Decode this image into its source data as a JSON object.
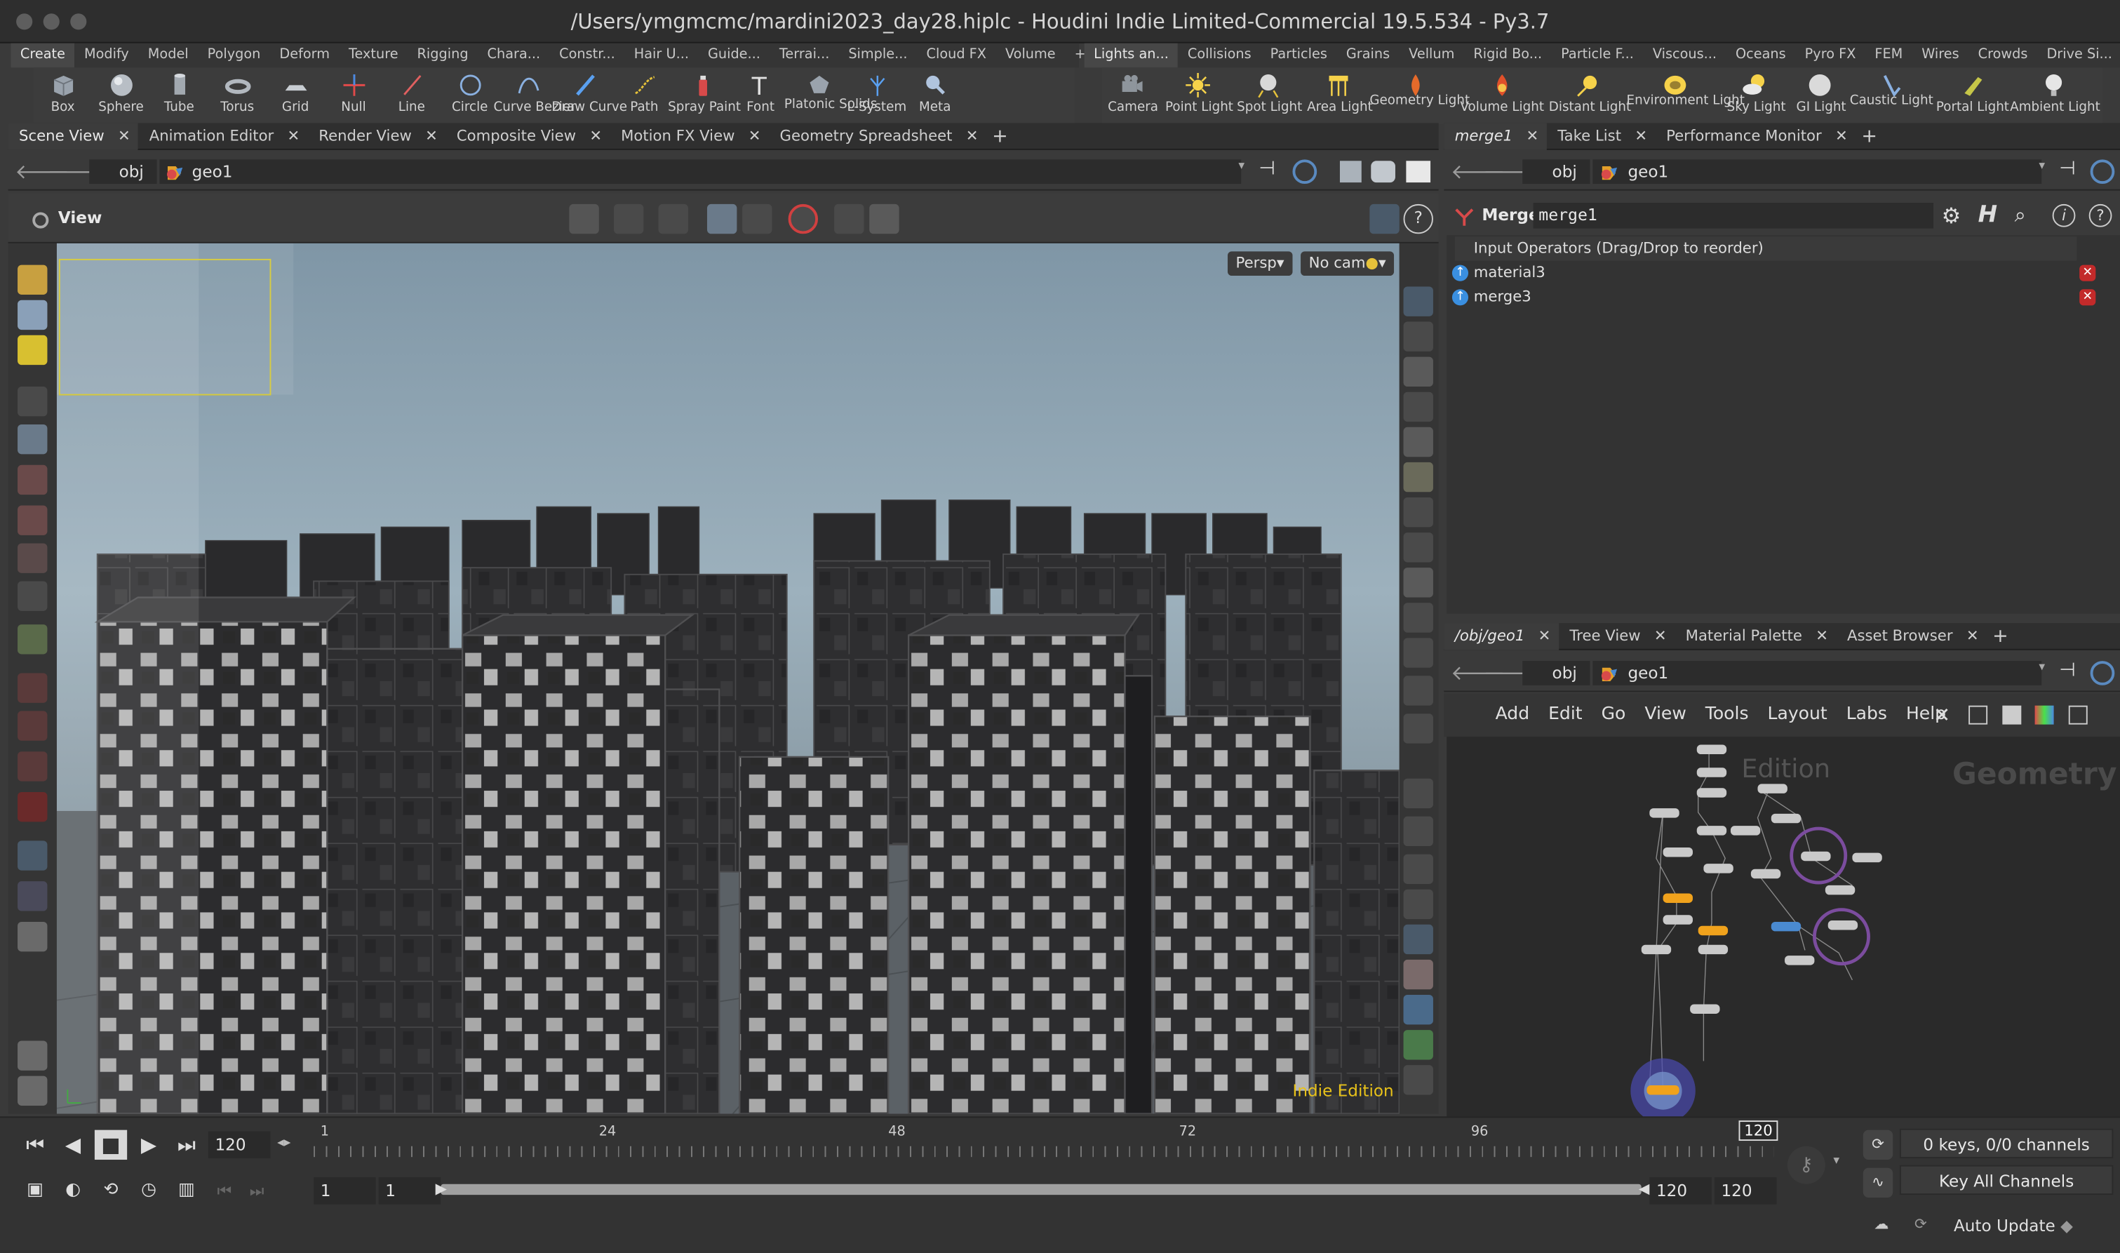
{
  "window": {
    "title": "/Users/ymgmcmc/mardini2023_day28.hiplc - Houdini Indie Limited-Commercial 19.5.534 - Py3.7"
  },
  "shelf_left": {
    "tabs": [
      "Create",
      "Modify",
      "Model",
      "Polygon",
      "Deform",
      "Texture",
      "Rigging",
      "Chara...",
      "Constr...",
      "Hair U...",
      "Guide...",
      "Terrai...",
      "Simple...",
      "Cloud FX",
      "Volume"
    ],
    "tools": [
      {
        "label": "Box",
        "icon": "box-icon"
      },
      {
        "label": "Sphere",
        "icon": "sphere-icon"
      },
      {
        "label": "Tube",
        "icon": "tube-icon"
      },
      {
        "label": "Torus",
        "icon": "torus-icon"
      },
      {
        "label": "Grid",
        "icon": "grid-icon"
      },
      {
        "label": "Null",
        "icon": "null-icon"
      },
      {
        "label": "Line",
        "icon": "line-icon"
      },
      {
        "label": "Circle",
        "icon": "circle-icon"
      },
      {
        "label": "Curve Bezier",
        "icon": "curve-bezier-icon"
      },
      {
        "label": "Draw Curve",
        "icon": "draw-curve-icon"
      },
      {
        "label": "Path",
        "icon": "path-icon"
      },
      {
        "label": "Spray Paint",
        "icon": "spray-paint-icon"
      },
      {
        "label": "Font",
        "icon": "font-icon"
      },
      {
        "label": "Platonic Solids",
        "icon": "platonic-icon"
      },
      {
        "label": "L-System",
        "icon": "lsystem-icon"
      },
      {
        "label": "Meta",
        "icon": "meta-icon"
      }
    ]
  },
  "shelf_right": {
    "tabs": [
      "Lights an...",
      "Collisions",
      "Particles",
      "Grains",
      "Vellum",
      "Rigid Bo...",
      "Particle F...",
      "Viscous...",
      "Oceans",
      "Pyro FX",
      "FEM",
      "Wires",
      "Crowds",
      "Drive Si..."
    ],
    "tools": [
      {
        "label": "Camera",
        "icon": "camera-icon"
      },
      {
        "label": "Point Light",
        "icon": "point-light-icon"
      },
      {
        "label": "Spot Light",
        "icon": "spot-light-icon"
      },
      {
        "label": "Area Light",
        "icon": "area-light-icon"
      },
      {
        "label": "Geometry Light",
        "icon": "geometry-light-icon"
      },
      {
        "label": "Volume Light",
        "icon": "volume-light-icon"
      },
      {
        "label": "Distant Light",
        "icon": "distant-light-icon"
      },
      {
        "label": "Environment Light",
        "icon": "environment-light-icon"
      },
      {
        "label": "Sky Light",
        "icon": "sky-light-icon"
      },
      {
        "label": "GI Light",
        "icon": "gi-light-icon"
      },
      {
        "label": "Caustic Light",
        "icon": "caustic-light-icon"
      },
      {
        "label": "Portal Light",
        "icon": "portal-light-icon"
      },
      {
        "label": "Ambient Light",
        "icon": "ambient-light-icon"
      }
    ]
  },
  "scene_pane": {
    "tabs": [
      "Scene View",
      "Animation Editor",
      "Render View",
      "Composite View",
      "Motion FX View",
      "Geometry Spreadsheet"
    ],
    "path": [
      "obj",
      "geo1"
    ],
    "view_label": "View",
    "persp_label": "Persp",
    "cam_label": "No cam",
    "watermark": "Indie Edition"
  },
  "param_pane": {
    "tabs": [
      "merge1",
      "Take List",
      "Performance Monitor"
    ],
    "path": [
      "obj",
      "geo1"
    ],
    "node_type": "Merge",
    "node_name": "merge1",
    "list_header": "Input Operators (Drag/Drop to reorder)",
    "inputs": [
      "material3",
      "merge3"
    ]
  },
  "network_pane": {
    "tabs": [
      "/obj/geo1",
      "Tree View",
      "Material Palette",
      "Asset Browser"
    ],
    "path": [
      "obj",
      "geo1"
    ],
    "menu": [
      "Add",
      "Edit",
      "Go",
      "View",
      "Tools",
      "Layout",
      "Labs",
      "Help"
    ],
    "watermark_edition": "Edition",
    "watermark_context": "Geometry"
  },
  "timeline": {
    "current_frame": "120",
    "ticks": [
      "1",
      "24",
      "48",
      "72",
      "96"
    ],
    "marker_frame": "120",
    "range_start": "1",
    "range_start2": "1",
    "range_end": "120",
    "range_end2": "120",
    "keys_status": "0 keys, 0/0 channels",
    "key_channels_label": "Key All Channels",
    "auto_update": "Auto Update"
  },
  "colors": {
    "accent_orange": "#f0a21c",
    "watermark_yellow": "#e8c21a",
    "delete_red": "#c32a2a",
    "input_blue": "#3a8fe0",
    "network_highlight": "#7b4c9e"
  }
}
